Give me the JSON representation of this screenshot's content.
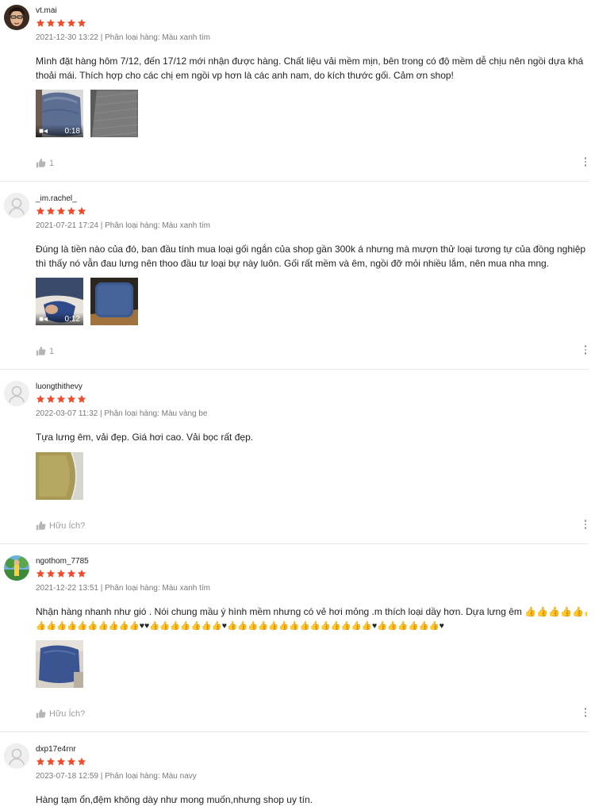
{
  "colors": {
    "star": "#ee4d2d",
    "meta": "#757575",
    "like": "#999999"
  },
  "reviews": [
    {
      "username": "vt.mai",
      "rating": 5,
      "date": "2021-12-30 13:22",
      "variation": "Phân loại hàng: Màu xanh tím",
      "content": "Mình đặt hàng hôm 7/12, đến 17/12 mới nhận được hàng. Chất liệu vải mềm mịn, bên trong có độ mềm dễ chịu nên ngồi dựa khá thoải mái. Thích hợp cho các chị em ngồi vp hơn là các anh nam, do kích thước gối. Cảm ơn shop!",
      "video_duration": "0:18",
      "likes": "1"
    },
    {
      "username": "_im.rachel_",
      "rating": 5,
      "date": "2021-07-21 17:24",
      "variation": "Phân loại hàng: Màu xanh tím",
      "content": "Đúng là tiền nào của đó, ban đầu tính mua loại gối ngắn của shop gần 300k á nhưng mà mượn thử loại tương tự của đồng nghiệp thì thấy nó vẫn đau lưng nên thoo đầu tư loại bự này luôn. Gối rất mềm và êm, ngồi đỡ mỏi nhiều lắm, nên mua nha mng.",
      "video_duration": "0:12",
      "likes": "1"
    },
    {
      "username": "luongthithevy",
      "rating": 5,
      "date": "2022-03-07 11:32",
      "variation": "Phân loại hàng: Màu vàng be",
      "content": "Tựa lưng êm, vải đẹp. Giá hơi cao. Vải bọc rất đẹp.",
      "likes": "Hữu Ích?"
    },
    {
      "username": "ngothom_7785",
      "rating": 5,
      "date": "2021-12-22 13:51",
      "variation": "Phân loại hàng: Màu xanh tím",
      "content": "Nhận hàng nhanh như gió . Nói chung mầu ý hình mềm nhưng có vẻ hơi mỏng .m thích loại dầy hơn. Dựa lưng êm 👍👍👍👍👍👍",
      "content_line2": "👍👍👍👍👍👍👍👍👍👍♥♥👍👍👍👍👍👍👍♥👍👍👍👍👍👍👍👍👍👍👍👍👍👍♥👍👍👍👍👍👍♥",
      "likes": "Hữu Ích?"
    },
    {
      "username": "dxp17e4rnr",
      "rating": 5,
      "date": "2023-07-18 12:59",
      "variation": "Phân loại hàng: Màu navy",
      "content": "Hàng tạm ổn,đệm không dày như mong muốn,nhưng shop uy tín."
    }
  ]
}
